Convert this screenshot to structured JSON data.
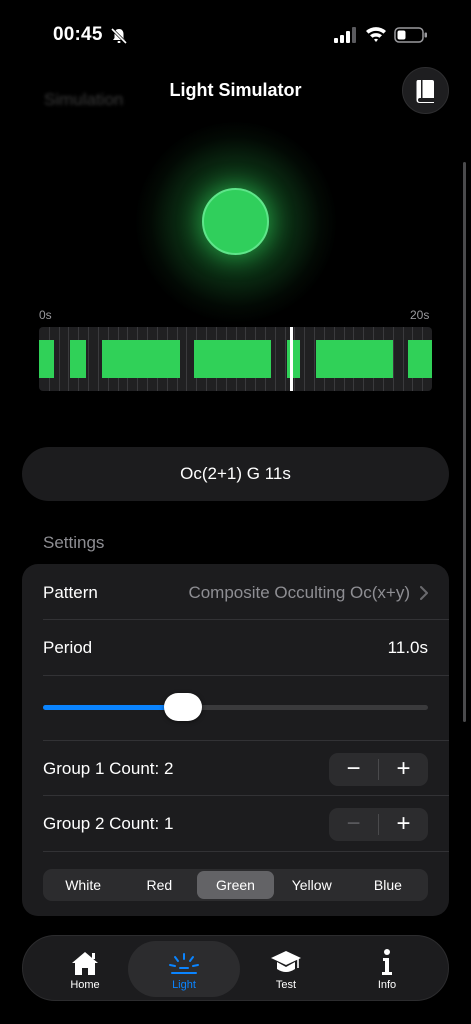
{
  "status_bar": {
    "time": "00:45"
  },
  "nav": {
    "title": "Light Simulator",
    "ghost_title": "Simulation"
  },
  "light": {
    "color": "#30d158",
    "state": "on"
  },
  "timeline": {
    "start_label": "0s",
    "end_label": "20s",
    "duration_s": 20,
    "segments": [
      {
        "start": 0.0,
        "end": 0.75
      },
      {
        "start": 1.6,
        "end": 2.4
      },
      {
        "start": 3.2,
        "end": 7.2
      },
      {
        "start": 7.9,
        "end": 11.8
      },
      {
        "start": 12.6,
        "end": 13.3
      },
      {
        "start": 14.1,
        "end": 18.0
      },
      {
        "start": 18.8,
        "end": 20.0
      }
    ],
    "cursor_s": 12.8
  },
  "characteristic": "Oc(2+1) G 11s",
  "settings": {
    "header": "Settings",
    "pattern_label": "Pattern",
    "pattern_value": "Composite Occulting Oc(x+y)",
    "period_label": "Period",
    "period_value": "11.0s",
    "period_slider_fraction": 0.35,
    "group1_label": "Group 1 Count: 2",
    "group2_label": "Group 2 Count: 1",
    "stepper_minus": "−",
    "stepper_plus": "+",
    "colors": [
      "White",
      "Red",
      "Green",
      "Yellow",
      "Blue"
    ],
    "selected_color": "Green"
  },
  "tabs": [
    {
      "label": "Home",
      "icon": "house-icon"
    },
    {
      "label": "Light",
      "icon": "light-beams-icon",
      "active": true
    },
    {
      "label": "Test",
      "icon": "graduation-cap-icon"
    },
    {
      "label": "Info",
      "icon": "info-icon"
    }
  ],
  "accent_color": "#0a84ff"
}
